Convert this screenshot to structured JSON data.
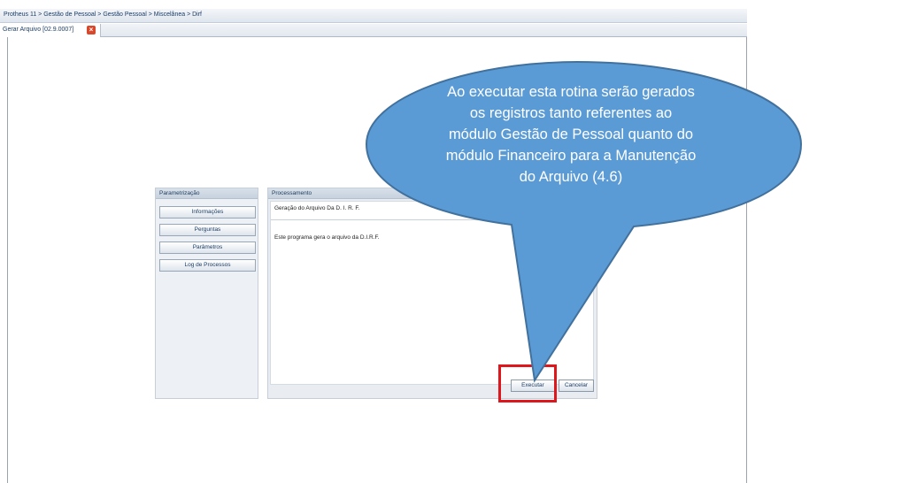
{
  "breadcrumb": "Protheus 11 > Gestão de Pessoal > Gestão Pessoal > Miscelânea > Dirf",
  "tab": {
    "label": "Gerar Arquivo [02.9.0007]",
    "close_icon": "close-icon"
  },
  "left_panel": {
    "title": "Parametrização",
    "buttons": [
      "Informações",
      "Perguntas",
      "Parâmetros",
      "Log de Processos"
    ]
  },
  "right_panel": {
    "title": "Processamento",
    "heading": "Geração do Arquivo Da D. I. R. F.",
    "description": "Este programa gera o arquivo da D.I.R.F.",
    "execute_label": "Executar",
    "cancel_label": "Cancelar"
  },
  "callout": {
    "lines": [
      "Ao executar esta rotina serão gerados",
      "os registros tanto referentes ao",
      "módulo Gestão de Pessoal quanto do",
      "módulo Financeiro para a Manutenção",
      "do Arquivo (4.6)"
    ],
    "fill": "#5b9bd5",
    "stroke": "#41719c",
    "highlight": "#e0161d"
  }
}
